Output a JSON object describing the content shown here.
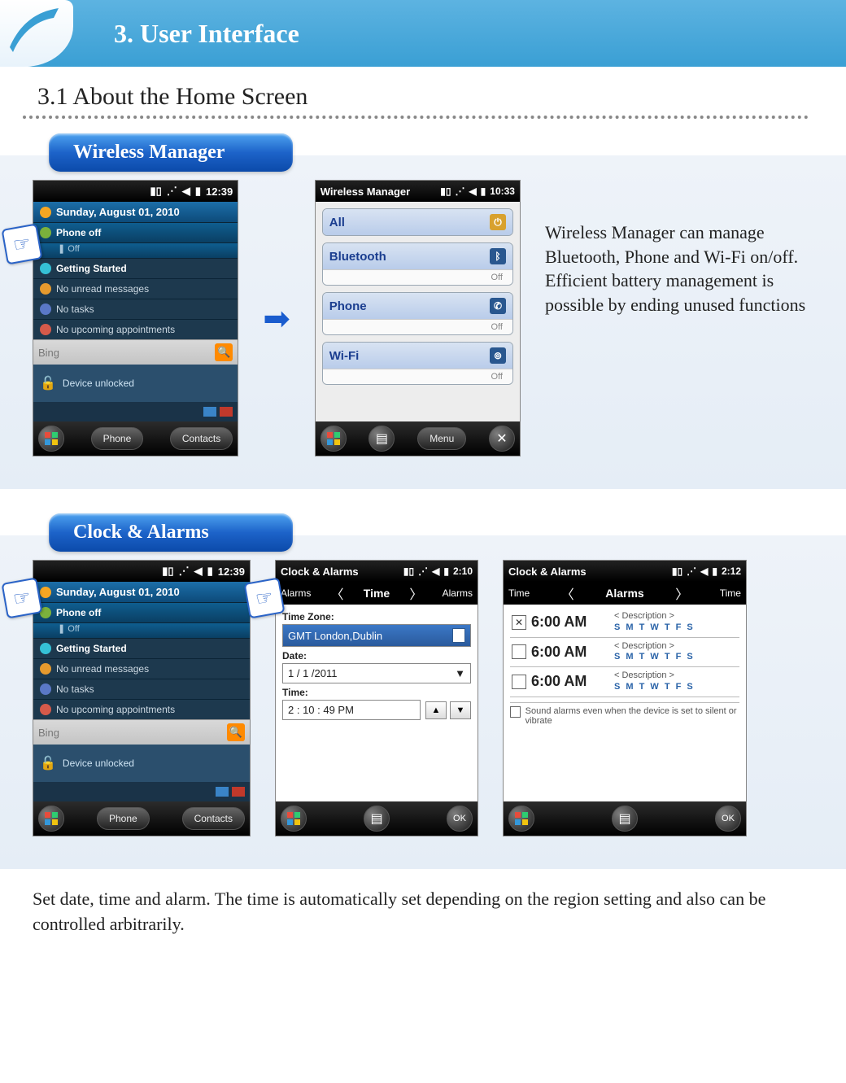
{
  "chapter": {
    "title": "3. User Interface"
  },
  "section": {
    "title": "3.1 About the Home Screen"
  },
  "sub1": {
    "heading": "Wireless Manager",
    "desc": "Wireless Manager can manage Bluetooth, Phone and Wi-Fi on/off.\nEfficient battery management is possible by ending unused functions",
    "home": {
      "clock": "12:39",
      "date": "Sunday, August 01, 2010",
      "phone_title": "Phone off",
      "phone_sub": "Off",
      "rows": [
        "Getting Started",
        "No unread messages",
        "No tasks",
        "No upcoming appointments"
      ],
      "search": "Bing",
      "unlock": "Device unlocked",
      "soft_left": "Phone",
      "soft_right": "Contacts"
    },
    "wm": {
      "title": "Wireless Manager",
      "clock": "10:33",
      "all": "All",
      "items": [
        {
          "name": "Bluetooth",
          "state": "Off"
        },
        {
          "name": "Phone",
          "state": "Off"
        },
        {
          "name": "Wi-Fi",
          "state": "Off"
        }
      ],
      "menu": "Menu"
    }
  },
  "sub2": {
    "heading": "Clock & Alarms",
    "home": {
      "clock": "12:39",
      "date": "Sunday, August 01, 2010",
      "phone_title": "Phone off",
      "phone_sub": "Off",
      "rows": [
        "Getting Started",
        "No unread messages",
        "No tasks",
        "No upcoming appointments"
      ],
      "search": "Bing",
      "unlock": "Device unlocked",
      "soft_left": "Phone",
      "soft_right": "Contacts"
    },
    "time_screen": {
      "title": "Clock & Alarms",
      "clock": "2:10",
      "tab_left": "Alarms",
      "tab_mid": "Time",
      "tab_right": "Alarms",
      "tz_label": "Time Zone:",
      "tz_value": "GMT London,Dublin",
      "date_label": "Date:",
      "date_value": "1  /  1  /2011",
      "time_label": "Time:",
      "time_value": "2  :  10 :  49   PM",
      "ok": "OK"
    },
    "alarms_screen": {
      "title": "Clock & Alarms",
      "clock": "2:12",
      "tab_left": "Time",
      "tab_mid": "Alarms",
      "tab_right": "Time",
      "alarms": [
        {
          "checked": true,
          "time": "6:00 AM",
          "desc": "< Description >",
          "days": "S M T W T F S"
        },
        {
          "checked": false,
          "time": "6:00 AM",
          "desc": "< Description >",
          "days": "S M T W T F S"
        },
        {
          "checked": false,
          "time": "6:00 AM",
          "desc": "< Description >",
          "days": "S M T W T F S"
        }
      ],
      "note": "Sound alarms even when the device is set to silent or vibrate",
      "ok": "OK"
    },
    "caption": "Set date, time and alarm. The time is automatically set depending on the region setting and also can be controlled arbitrarily."
  }
}
